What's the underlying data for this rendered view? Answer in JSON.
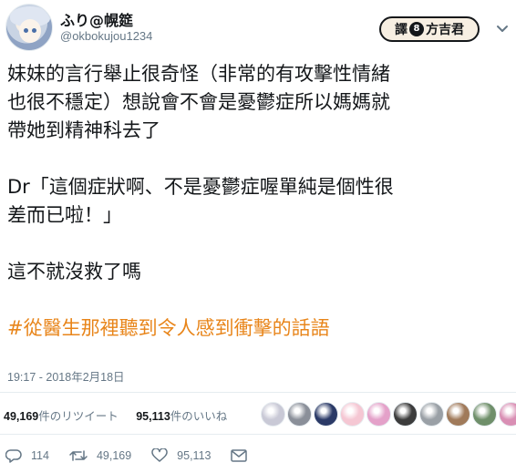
{
  "user": {
    "display_name": "ふり@幌筵",
    "handle": "@okbokujou1234"
  },
  "translator_badge": {
    "prefix": "譯",
    "symbol": "8",
    "name": "方吉君"
  },
  "tweet": {
    "lines": [
      "妹妹的言行舉止很奇怪（非常的有攻擊性情緒",
      "也很不穩定）想說會不會是憂鬱症所以媽媽就",
      "帶她到精神科去了",
      "",
      "Dr「這個症狀啊、不是憂鬱症喔單純是個性很",
      "差而已啦！」",
      "",
      "這不就沒救了嗎",
      ""
    ],
    "hashtag": "#從醫生那裡聽到令人感到衝擊的話語",
    "timestamp": "19:17 - 2018年2月18日"
  },
  "stats": {
    "retweets_count": "49,169",
    "retweets_label": "件のリツイート",
    "likes_count": "95,113",
    "likes_label": "件のいいね"
  },
  "likers": [
    {
      "icon": "avatar-1",
      "color": "#c9c9d6"
    },
    {
      "icon": "avatar-2",
      "color": "#8a8f99"
    },
    {
      "icon": "avatar-3",
      "color": "#2b3a67"
    },
    {
      "icon": "avatar-4",
      "color": "#f5c7d3"
    },
    {
      "icon": "avatar-5",
      "color": "#e4a1c9"
    },
    {
      "icon": "avatar-6",
      "color": "#3c3c3c"
    },
    {
      "icon": "avatar-7",
      "color": "#9aa0a6"
    },
    {
      "icon": "avatar-8",
      "color": "#a07a5a"
    },
    {
      "icon": "avatar-9",
      "color": "#6f8f6a"
    },
    {
      "icon": "avatar-10",
      "color": "#d98fb4"
    }
  ],
  "actions": {
    "reply_count": "114",
    "retweet_count": "49,169",
    "like_count": "95,113"
  },
  "colors": {
    "hashtag": "#e8851a",
    "secondary_text": "#657786",
    "primary_text": "#14171a"
  }
}
